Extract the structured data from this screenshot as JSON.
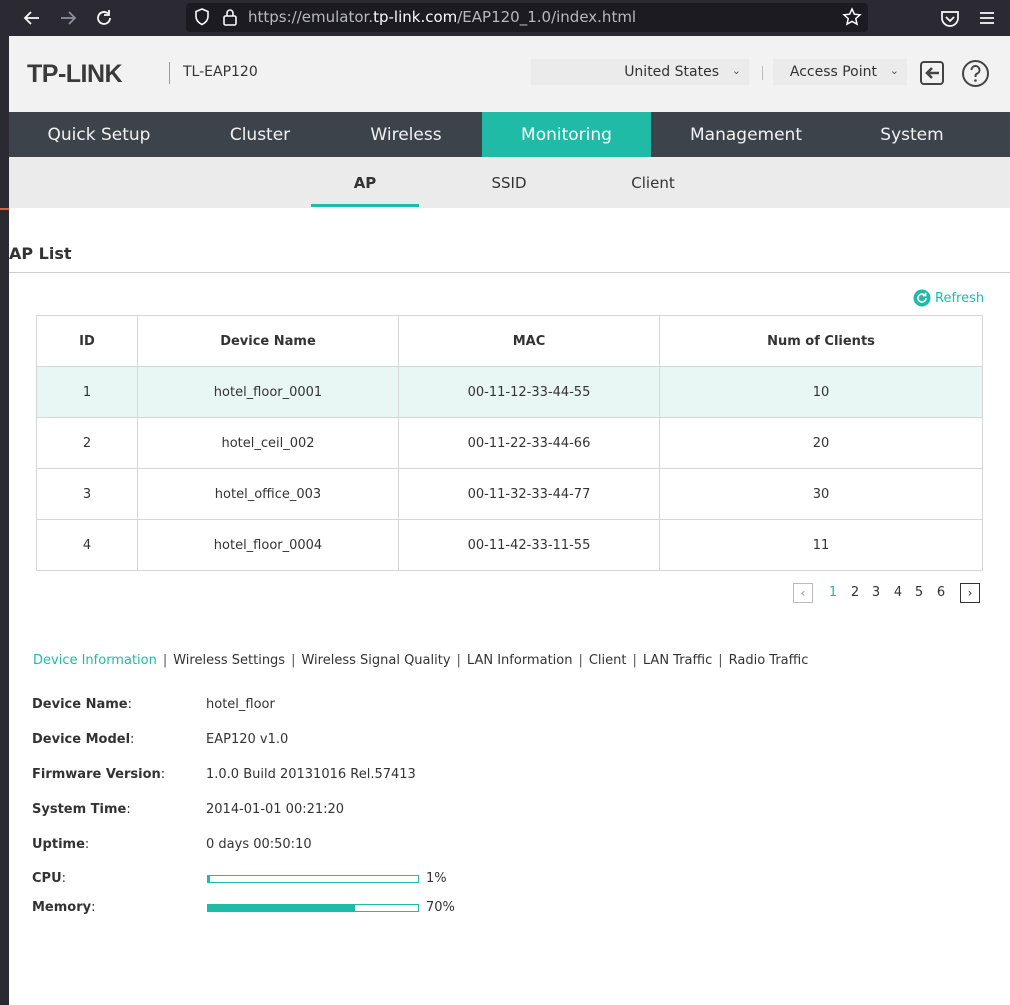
{
  "browser": {
    "url_prefix": "https://emulator.",
    "url_host": "tp-link.com",
    "url_path": "/EAP120_1.0/index.html"
  },
  "header": {
    "logo": "TP-LINK",
    "model": "TL-EAP120",
    "region": "United States",
    "mode": "Access Point"
  },
  "main_nav": {
    "tabs": [
      "Quick Setup",
      "Cluster",
      "Wireless",
      "Monitoring",
      "Management",
      "System"
    ],
    "active": "Monitoring"
  },
  "sub_nav": {
    "tabs": [
      "AP",
      "SSID",
      "Client"
    ],
    "active": "AP"
  },
  "ap_list": {
    "title": "AP List",
    "refresh_label": "Refresh",
    "columns": [
      "ID",
      "Device Name",
      "MAC",
      "Num of Clients"
    ],
    "rows": [
      [
        "1",
        "hotel_floor_0001",
        "00-11-12-33-44-55",
        "10"
      ],
      [
        "2",
        "hotel_ceil_002",
        "00-11-22-33-44-66",
        "20"
      ],
      [
        "3",
        "hotel_office_003",
        "00-11-32-33-44-77",
        "30"
      ],
      [
        "4",
        "hotel_floor_0004",
        "00-11-42-33-11-55",
        "11"
      ]
    ],
    "selected_row": 0
  },
  "pagination": {
    "pages": [
      "1",
      "2",
      "3",
      "4",
      "5",
      "6"
    ],
    "current": "1"
  },
  "detail_tabs": {
    "items": [
      "Device Information",
      "Wireless Settings",
      "Wireless Signal Quality",
      "LAN Information",
      "Client",
      "LAN Traffic",
      "Radio Traffic"
    ],
    "active": "Device Information"
  },
  "device_info": {
    "device_name": {
      "label": "Device Name",
      "value": "hotel_floor"
    },
    "device_model": {
      "label": "Device Model",
      "value": "EAP120 v1.0"
    },
    "firmware": {
      "label": "Firmware Version",
      "value": "1.0.0 Build 20131016 Rel.57413"
    },
    "system_time": {
      "label": "System Time",
      "value": "2014-01-01 00:21:20"
    },
    "uptime": {
      "label": "Uptime",
      "value": "0 days 00:50:10"
    },
    "cpu": {
      "label": "CPU",
      "value": "1%",
      "fraction": 0.01
    },
    "memory": {
      "label": "Memory",
      "value": "70%",
      "fraction": 0.7
    }
  },
  "colors": {
    "accent": "#1fbba6",
    "nav_bg": "#3d434b",
    "selected_row": "#e8f7f4"
  },
  "icons": [
    "back-icon",
    "forward-icon",
    "reload-icon",
    "shield-icon",
    "lock-icon",
    "star-icon",
    "pocket-icon",
    "menu-icon",
    "chevron-down-icon",
    "logout-icon",
    "help-icon",
    "refresh-icon",
    "chevron-left-icon",
    "chevron-right-icon"
  ]
}
